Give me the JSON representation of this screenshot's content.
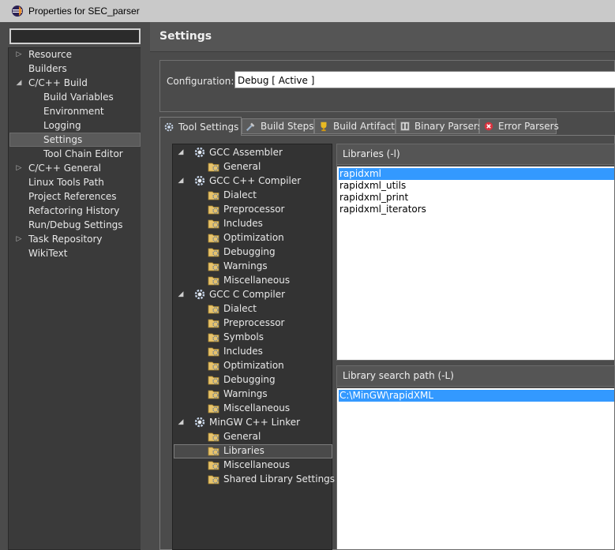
{
  "window": {
    "title": "Properties for SEC_parser"
  },
  "nav": {
    "filter_value": "",
    "items": [
      {
        "label": "Resource",
        "expandable": true
      },
      {
        "label": "Builders",
        "expandable": false
      },
      {
        "label": "C/C++ Build",
        "expandable": true,
        "expanded": true
      },
      {
        "label": "Build Variables",
        "expandable": false
      },
      {
        "label": "Environment",
        "expandable": false
      },
      {
        "label": "Logging",
        "expandable": false
      },
      {
        "label": "Settings",
        "expandable": false,
        "selected": true
      },
      {
        "label": "Tool Chain Editor",
        "expandable": false
      },
      {
        "label": "C/C++ General",
        "expandable": true
      },
      {
        "label": "Linux Tools Path",
        "expandable": false
      },
      {
        "label": "Project References",
        "expandable": false
      },
      {
        "label": "Refactoring History",
        "expandable": false
      },
      {
        "label": "Run/Debug Settings",
        "expandable": false
      },
      {
        "label": "Task Repository",
        "expandable": true
      },
      {
        "label": "WikiText",
        "expandable": false
      }
    ]
  },
  "settings": {
    "heading": "Settings",
    "configuration_label": "Configuration:",
    "configuration_value": "Debug  [ Active ]"
  },
  "tabs": [
    {
      "label": "Tool Settings",
      "icon": "tool-settings-icon",
      "active": true
    },
    {
      "label": "Build Steps",
      "icon": "build-steps-icon"
    },
    {
      "label": "Build Artifact",
      "icon": "trophy-icon"
    },
    {
      "label": "Binary Parsers",
      "icon": "binary-parsers-icon"
    },
    {
      "label": "Error Parsers",
      "icon": "error-icon"
    }
  ],
  "tool_tree": [
    {
      "label": "GCC Assembler",
      "level": 0,
      "icon": "tool-gear-icon"
    },
    {
      "label": "General",
      "level": 1,
      "icon": "folder-options-icon"
    },
    {
      "label": "GCC C++ Compiler",
      "level": 0,
      "icon": "tool-gear-icon"
    },
    {
      "label": "Dialect",
      "level": 1,
      "icon": "folder-options-icon"
    },
    {
      "label": "Preprocessor",
      "level": 1,
      "icon": "folder-options-icon"
    },
    {
      "label": "Includes",
      "level": 1,
      "icon": "folder-options-icon"
    },
    {
      "label": "Optimization",
      "level": 1,
      "icon": "folder-options-icon"
    },
    {
      "label": "Debugging",
      "level": 1,
      "icon": "folder-options-icon"
    },
    {
      "label": "Warnings",
      "level": 1,
      "icon": "folder-options-icon"
    },
    {
      "label": "Miscellaneous",
      "level": 1,
      "icon": "folder-options-icon"
    },
    {
      "label": "GCC C Compiler",
      "level": 0,
      "icon": "tool-gear-icon"
    },
    {
      "label": "Dialect",
      "level": 1,
      "icon": "folder-options-icon"
    },
    {
      "label": "Preprocessor",
      "level": 1,
      "icon": "folder-options-icon"
    },
    {
      "label": "Symbols",
      "level": 1,
      "icon": "folder-options-icon"
    },
    {
      "label": "Includes",
      "level": 1,
      "icon": "folder-options-icon"
    },
    {
      "label": "Optimization",
      "level": 1,
      "icon": "folder-options-icon"
    },
    {
      "label": "Debugging",
      "level": 1,
      "icon": "folder-options-icon"
    },
    {
      "label": "Warnings",
      "level": 1,
      "icon": "folder-options-icon"
    },
    {
      "label": "Miscellaneous",
      "level": 1,
      "icon": "folder-options-icon"
    },
    {
      "label": "MinGW C++ Linker",
      "level": 0,
      "icon": "tool-gear-icon"
    },
    {
      "label": "General",
      "level": 1,
      "icon": "folder-options-icon"
    },
    {
      "label": "Libraries",
      "level": 1,
      "icon": "folder-options-icon",
      "selected": true
    },
    {
      "label": "Miscellaneous",
      "level": 1,
      "icon": "folder-options-icon"
    },
    {
      "label": "Shared Library Settings",
      "level": 1,
      "icon": "folder-options-icon"
    }
  ],
  "libraries": {
    "header": "Libraries (-l)",
    "items": [
      "rapidxml",
      "rapidxml_utils",
      "rapidxml_print",
      "rapidxml_iterators"
    ],
    "selected_index": 0
  },
  "library_paths": {
    "header": "Library search path (-L)",
    "items": [
      "C:\\MinGW\\rapidXML"
    ],
    "selected_index": 0
  }
}
